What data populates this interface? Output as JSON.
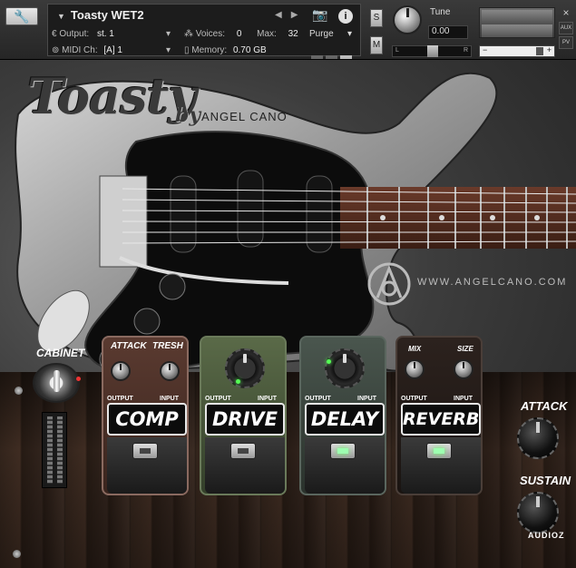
{
  "header": {
    "instrument_name": "Toasty WET2",
    "output_label": "Output:",
    "output_value": "st. 1",
    "voices_label": "Voices:",
    "voices_value": "0",
    "max_label": "Max:",
    "max_value": "32",
    "purge_label": "Purge",
    "midi_label": "MIDI Ch:",
    "midi_value": "[A] 1",
    "memory_label": "Memory:",
    "memory_value": "0.70 GB",
    "solo_label": "S",
    "mute_label": "M",
    "tune_label": "Tune",
    "tune_value": "0.00",
    "pan_left": "L",
    "pan_right": "R",
    "vol_minus": "−",
    "vol_plus": "+",
    "side_buttons": [
      "×",
      "AUX",
      "PV"
    ]
  },
  "branding": {
    "logo": "Toasty",
    "by": "by",
    "author": "ANGEL CANO",
    "website": "WWW.ANGELCANO.COM"
  },
  "cabinet": {
    "label": "CABINET"
  },
  "pedals": {
    "comp": {
      "name": "COMP",
      "knob1": "ATTACK",
      "knob2": "TRESH",
      "output": "OUTPUT",
      "input": "INPUT",
      "color": "#5a3a30"
    },
    "drive": {
      "name": "DRIVE",
      "output": "OUTPUT",
      "input": "INPUT",
      "color": "#4b5a3c"
    },
    "delay": {
      "name": "DELAY",
      "output": "OUTPUT",
      "input": "INPUT",
      "color": "#3f4a44"
    },
    "reverb": {
      "name": "REVERB",
      "knob1": "MIX",
      "knob2": "SIZE",
      "output": "OUTPUT",
      "input": "INPUT",
      "color": "#2c221e"
    }
  },
  "amp": {
    "attack_label": "ATTACK",
    "sustain_label": "SUSTAIN"
  },
  "watermark": "AUDIOZ"
}
